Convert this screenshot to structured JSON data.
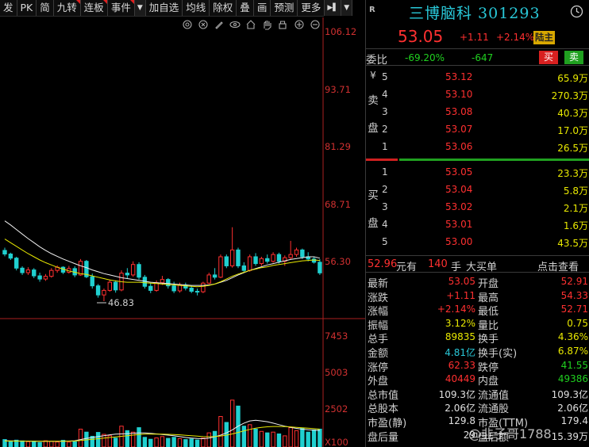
{
  "toolbar": {
    "items": [
      "发",
      "PK",
      "简",
      "九转",
      "连板",
      "事件",
      "加自选",
      "均线",
      "除权",
      "叠",
      "画",
      "预测",
      "更多"
    ]
  },
  "chart": {
    "price_labels": [
      "106.12",
      "93.71",
      "81.29",
      "68.71",
      "56.30"
    ],
    "volume_labels": [
      "7453",
      "5003",
      "2502",
      "X100"
    ],
    "low_label": "46.83"
  },
  "chart_data": {
    "type": "candlestick",
    "price_ylim": [
      46.83,
      106.12
    ],
    "volume_ylim": [
      0,
      7453
    ],
    "candles": [
      {
        "o": 58.0,
        "h": 58.6,
        "l": 56.7,
        "c": 57.2,
        "v": 500
      },
      {
        "o": 57.2,
        "h": 57.5,
        "l": 55.9,
        "c": 56.3,
        "v": 380
      },
      {
        "o": 56.3,
        "h": 56.6,
        "l": 53.6,
        "c": 54.1,
        "v": 460
      },
      {
        "o": 54.1,
        "h": 54.5,
        "l": 52.6,
        "c": 53.1,
        "v": 410
      },
      {
        "o": 53.1,
        "h": 54.3,
        "l": 52.6,
        "c": 53.7,
        "v": 360
      },
      {
        "o": 53.7,
        "h": 54.1,
        "l": 51.9,
        "c": 52.4,
        "v": 390
      },
      {
        "o": 52.4,
        "h": 53.1,
        "l": 51.1,
        "c": 51.7,
        "v": 300
      },
      {
        "o": 51.7,
        "h": 52.8,
        "l": 51.3,
        "c": 52.3,
        "v": 420
      },
      {
        "o": 52.3,
        "h": 54.1,
        "l": 52.0,
        "c": 53.6,
        "v": 380
      },
      {
        "o": 53.6,
        "h": 54.7,
        "l": 53.1,
        "c": 54.3,
        "v": 340
      },
      {
        "o": 54.3,
        "h": 54.5,
        "l": 52.8,
        "c": 53.2,
        "v": 450
      },
      {
        "o": 53.2,
        "h": 54.6,
        "l": 52.9,
        "c": 54.0,
        "v": 330
      },
      {
        "o": 54.0,
        "h": 54.5,
        "l": 52.1,
        "c": 52.6,
        "v": 350
      },
      {
        "o": 52.6,
        "h": 56.1,
        "l": 52.4,
        "c": 55.6,
        "v": 1200
      },
      {
        "o": 55.6,
        "h": 55.9,
        "l": 51.9,
        "c": 52.2,
        "v": 1000
      },
      {
        "o": 52.2,
        "h": 52.9,
        "l": 49.6,
        "c": 50.2,
        "v": 720
      },
      {
        "o": 50.2,
        "h": 50.6,
        "l": 47.6,
        "c": 48.2,
        "v": 980
      },
      {
        "o": 48.2,
        "h": 49.6,
        "l": 46.83,
        "c": 49.2,
        "v": 850
      },
      {
        "o": 49.2,
        "h": 51.6,
        "l": 48.9,
        "c": 51.0,
        "v": 760
      },
      {
        "o": 51.0,
        "h": 51.4,
        "l": 48.7,
        "c": 49.3,
        "v": 600
      },
      {
        "o": 49.3,
        "h": 53.6,
        "l": 49.0,
        "c": 53.0,
        "v": 1400
      },
      {
        "o": 53.0,
        "h": 54.1,
        "l": 51.9,
        "c": 52.6,
        "v": 1100
      },
      {
        "o": 52.6,
        "h": 55.6,
        "l": 52.2,
        "c": 54.9,
        "v": 1000
      },
      {
        "o": 54.9,
        "h": 55.4,
        "l": 51.6,
        "c": 52.1,
        "v": 1300
      },
      {
        "o": 52.1,
        "h": 52.6,
        "l": 49.6,
        "c": 50.1,
        "v": 650
      },
      {
        "o": 50.1,
        "h": 50.8,
        "l": 48.6,
        "c": 49.2,
        "v": 520
      },
      {
        "o": 49.2,
        "h": 51.4,
        "l": 48.9,
        "c": 50.9,
        "v": 610
      },
      {
        "o": 50.9,
        "h": 52.4,
        "l": 50.4,
        "c": 51.6,
        "v": 700
      },
      {
        "o": 51.6,
        "h": 51.9,
        "l": 49.6,
        "c": 50.2,
        "v": 580
      },
      {
        "o": 50.2,
        "h": 51.1,
        "l": 48.6,
        "c": 49.1,
        "v": 650
      },
      {
        "o": 49.1,
        "h": 50.9,
        "l": 48.7,
        "c": 50.4,
        "v": 560
      },
      {
        "o": 50.4,
        "h": 50.9,
        "l": 49.2,
        "c": 49.7,
        "v": 500
      },
      {
        "o": 49.7,
        "h": 50.3,
        "l": 48.6,
        "c": 49.0,
        "v": 540
      },
      {
        "o": 49.0,
        "h": 49.6,
        "l": 48.1,
        "c": 48.9,
        "v": 470
      },
      {
        "o": 48.9,
        "h": 51.1,
        "l": 48.6,
        "c": 50.8,
        "v": 600
      },
      {
        "o": 50.8,
        "h": 53.1,
        "l": 50.6,
        "c": 52.6,
        "v": 950
      },
      {
        "o": 52.6,
        "h": 54.1,
        "l": 51.6,
        "c": 52.1,
        "v": 1050
      },
      {
        "o": 52.1,
        "h": 57.1,
        "l": 51.9,
        "c": 56.6,
        "v": 2050
      },
      {
        "o": 56.6,
        "h": 57.1,
        "l": 54.1,
        "c": 54.6,
        "v": 1650
      },
      {
        "o": 54.6,
        "h": 63.1,
        "l": 54.2,
        "c": 58.1,
        "v": 3150
      },
      {
        "o": 58.1,
        "h": 58.6,
        "l": 54.1,
        "c": 54.6,
        "v": 2750
      },
      {
        "o": 54.6,
        "h": 55.4,
        "l": 53.1,
        "c": 53.6,
        "v": 1400
      },
      {
        "o": 53.6,
        "h": 57.1,
        "l": 53.3,
        "c": 56.6,
        "v": 1500
      },
      {
        "o": 56.6,
        "h": 57.4,
        "l": 54.6,
        "c": 55.1,
        "v": 1200
      },
      {
        "o": 55.1,
        "h": 56.6,
        "l": 54.6,
        "c": 56.2,
        "v": 1050
      },
      {
        "o": 56.2,
        "h": 57.1,
        "l": 55.1,
        "c": 55.6,
        "v": 950
      },
      {
        "o": 55.6,
        "h": 57.6,
        "l": 55.3,
        "c": 57.1,
        "v": 1000
      },
      {
        "o": 57.1,
        "h": 57.5,
        "l": 55.1,
        "c": 55.6,
        "v": 880
      },
      {
        "o": 55.6,
        "h": 56.9,
        "l": 54.6,
        "c": 56.4,
        "v": 750
      },
      {
        "o": 56.4,
        "h": 60.1,
        "l": 56.1,
        "c": 57.1,
        "v": 1300
      },
      {
        "o": 57.1,
        "h": 58.6,
        "l": 56.6,
        "c": 58.1,
        "v": 1100
      },
      {
        "o": 58.1,
        "h": 58.4,
        "l": 56.1,
        "c": 56.6,
        "v": 1250
      },
      {
        "o": 56.6,
        "h": 57.6,
        "l": 55.6,
        "c": 56.1,
        "v": 1000
      },
      {
        "o": 56.1,
        "h": 56.6,
        "l": 55.1,
        "c": 55.4,
        "v": 1150
      },
      {
        "o": 55.4,
        "h": 56.1,
        "l": 52.6,
        "c": 53.05,
        "v": 1200
      }
    ],
    "ma_price": [
      {
        "color": "#f0f0f0",
        "values": [
          64.5,
          63.6,
          62.6,
          61.6,
          60.6,
          59.7,
          58.8,
          58.0,
          57.3,
          56.7,
          56.1,
          55.6,
          55.1,
          54.6,
          54.2,
          53.7,
          53.3,
          52.9,
          52.6,
          52.3,
          52.0,
          51.8,
          51.6,
          51.4,
          51.2,
          51.0,
          50.9,
          50.8,
          50.7,
          50.6,
          50.5,
          50.4,
          50.3,
          50.3,
          50.3,
          50.4,
          50.6,
          51.0,
          51.4,
          52.0,
          52.6,
          53.1,
          53.6,
          54.0,
          54.4,
          54.8,
          55.1,
          55.4,
          55.7,
          56.0,
          56.2,
          56.4,
          56.6,
          56.6,
          56.3
        ]
      },
      {
        "color": "#e8e800",
        "values": [
          60.5,
          59.7,
          58.9,
          58.1,
          57.3,
          56.6,
          55.9,
          55.3,
          54.8,
          54.3,
          53.9,
          53.5,
          53.2,
          52.9,
          52.7,
          52.4,
          52.1,
          51.8,
          51.5,
          51.3,
          51.1,
          51.0,
          51.0,
          51.0,
          50.9,
          50.8,
          50.7,
          50.6,
          50.5,
          50.4,
          50.3,
          50.2,
          50.1,
          50.0,
          50.1,
          50.3,
          50.6,
          51.1,
          51.7,
          52.3,
          52.8,
          53.2,
          53.6,
          53.9,
          54.2,
          54.4,
          54.7,
          54.9,
          55.1,
          55.3,
          55.5,
          55.7,
          55.8,
          55.9,
          55.8
        ]
      },
      {
        "color": "#e040e0",
        "values": [
          null,
          null,
          null,
          null,
          null,
          null,
          null,
          null,
          null,
          null,
          null,
          null,
          null,
          null,
          null,
          null,
          null,
          null,
          null,
          null,
          null,
          null,
          null,
          null,
          null,
          null,
          null,
          null,
          null,
          null,
          null,
          null,
          null,
          null,
          null,
          null,
          null,
          null,
          null,
          null,
          null,
          null,
          null,
          null,
          null,
          null,
          null,
          null,
          null,
          null,
          null,
          null,
          null,
          null,
          null
        ]
      }
    ],
    "ma_volume": [
      {
        "color": "#f0f0f0",
        "values": [
          420,
          410,
          405,
          400,
          395,
          390,
          385,
          380,
          378,
          380,
          390,
          400,
          420,
          500,
          580,
          640,
          700,
          760,
          820,
          860,
          880,
          900,
          920,
          950,
          940,
          920,
          880,
          840,
          800,
          760,
          700,
          640,
          600,
          570,
          560,
          600,
          680,
          800,
          950,
          1150,
          1400,
          1600,
          1750,
          1800,
          1750,
          1700,
          1600,
          1500,
          1400,
          1320,
          1250,
          1200,
          1160,
          1130,
          1110
        ]
      },
      {
        "color": "#e8e800",
        "values": [
          400,
          398,
          396,
          394,
          392,
          390,
          388,
          386,
          385,
          386,
          388,
          392,
          400,
          440,
          480,
          520,
          560,
          600,
          640,
          680,
          720,
          760,
          800,
          840,
          860,
          870,
          870,
          860,
          850,
          840,
          820,
          790,
          760,
          730,
          700,
          690,
          700,
          740,
          800,
          880,
          980,
          1080,
          1180,
          1260,
          1320,
          1360,
          1380,
          1380,
          1370,
          1350,
          1320,
          1290,
          1260,
          1230,
          1200
        ]
      }
    ]
  },
  "stock": {
    "tag": "R",
    "name": "三博脑科 301293",
    "price": "53.05",
    "change": "+1.11",
    "change_pct": "+2.14%",
    "badge": "陆主"
  },
  "weibi": {
    "label": "委比",
    "ratio": "-69.20%",
    "diff": "-647",
    "buy_label": "买",
    "sell_label": "卖"
  },
  "sell_book": {
    "label_top": "¥",
    "label_chars": [
      "卖",
      "盘"
    ],
    "rows": [
      {
        "level": "5",
        "price": "53.12",
        "vol": "65.9万"
      },
      {
        "level": "4",
        "price": "53.10",
        "vol": "270.3万"
      },
      {
        "level": "3",
        "price": "53.08",
        "vol": "40.3万"
      },
      {
        "level": "2",
        "price": "53.07",
        "vol": "17.0万"
      },
      {
        "level": "1",
        "price": "53.06",
        "vol": "26.5万"
      }
    ]
  },
  "buy_book": {
    "label_chars": [
      "买",
      "盘"
    ],
    "rows": [
      {
        "level": "1",
        "price": "53.05",
        "vol": "23.3万"
      },
      {
        "level": "2",
        "price": "53.04",
        "vol": "5.8万"
      },
      {
        "level": "3",
        "price": "53.02",
        "vol": "2.1万"
      },
      {
        "level": "4",
        "price": "53.01",
        "vol": "1.6万"
      },
      {
        "level": "5",
        "price": "53.00",
        "vol": "43.5万"
      }
    ]
  },
  "last_trade": {
    "price": "52.96",
    "unit": "元有",
    "vol": "140",
    "hand": "手",
    "type": "大买单",
    "detail_link": "点击查看"
  },
  "stats": [
    {
      "l1": "最新",
      "v1": "53.05",
      "c1": "red",
      "l2": "开盘",
      "v2": "52.91",
      "c2": "red"
    },
    {
      "l1": "涨跌",
      "v1": "+1.11",
      "c1": "red",
      "l2": "最高",
      "v2": "54.33",
      "c2": "red"
    },
    {
      "l1": "涨幅",
      "v1": "+2.14%",
      "c1": "red",
      "l2": "最低",
      "v2": "52.71",
      "c2": "red"
    },
    {
      "l1": "振幅",
      "v1": "3.12%",
      "c1": "yellow",
      "l2": "量比",
      "v2": "0.75",
      "c2": "yellow"
    },
    {
      "l1": "总手",
      "v1": "89835",
      "c1": "yellow",
      "l2": "换手",
      "v2": "4.36%",
      "c2": "yellow"
    },
    {
      "l1": "金额",
      "v1": "4.81亿",
      "c1": "cyan",
      "l2": "换手(实)",
      "v2": "6.87%",
      "c2": "yellow"
    },
    {
      "l1": "涨停",
      "v1": "62.33",
      "c1": "red",
      "l2": "跌停",
      "v2": "41.55",
      "c2": "green"
    },
    {
      "l1": "外盘",
      "v1": "40449",
      "c1": "red",
      "l2": "内盘",
      "v2": "49386",
      "c2": "green"
    },
    {
      "l1": "总市值",
      "v1": "109.3亿",
      "c1": "white",
      "l2": "流通值",
      "v2": "109.3亿",
      "c2": "white"
    },
    {
      "l1": "总股本",
      "v1": "2.06亿",
      "c1": "white",
      "l2": "流通股",
      "v2": "2.06亿",
      "c2": "white"
    },
    {
      "l1": "市盈(静)",
      "v1": "129.8",
      "c1": "white",
      "l2": "市盈(TTM)",
      "v2": "179.4",
      "c2": "white"
    },
    {
      "l1": "盘后量",
      "v1": "29",
      "c1": "white",
      "l2": "盘后额",
      "v2": "15.39万",
      "c2": "white"
    }
  ],
  "watermark": "@韭子哥1788",
  "colors": {
    "up": "#ff3030",
    "down": "#20d0d0",
    "axis": "#d03030",
    "ma5": "#f0f0f0",
    "ma10": "#e8e800"
  }
}
